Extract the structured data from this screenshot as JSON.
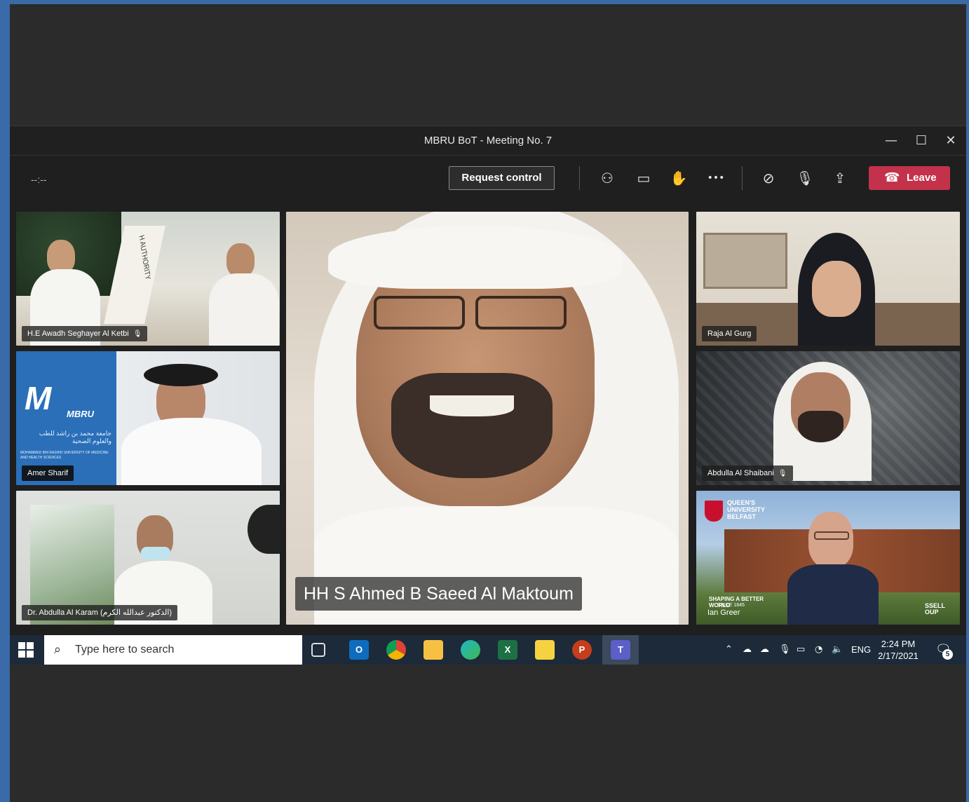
{
  "window": {
    "title": "MBRU BoT - Meeting No. 7",
    "minimize": "—",
    "maximize": "☐",
    "close": "✕"
  },
  "toolbar": {
    "timer": "--:--",
    "request_control": "Request control",
    "leave": "Leave",
    "icons": [
      "people-icon",
      "chat-icon",
      "raise-hand-icon",
      "more-options-icon",
      "camera-off-icon",
      "mic-off-icon",
      "share-screen-icon"
    ],
    "icon_glyphs": {
      "people": "⚇",
      "chat": "▭",
      "hand": "✋",
      "more": "•••",
      "camera": "⊘",
      "mic": "🎙",
      "share": "⇪",
      "phone": "☎"
    }
  },
  "participants": {
    "p1": "H.E Awadh Seghayer Al Ketbi",
    "p2": "Amer Sharif",
    "p3": "Dr. Abdulla Al Karam (الدكتور عبدالله الكرم)",
    "main": "HH S Ahmed B Saeed Al Maktoum",
    "p4": "Raja Al Gurg",
    "p5": "Abdulla Al Shaibani",
    "p6": "Ian Greer"
  },
  "backgrounds": {
    "authority_text": "H AUTHORITY",
    "mbru_logo": "MBRU",
    "mbru_arabic": "جامعة محمد بن راشد للطب والعلوم الصحية",
    "mbru_english": "MOHAMMED BIN RASHID UNIVERSITY OF MEDICINE AND HEALTH SCIENCES",
    "qub_name": "QUEEN'S UNIVERSITY BELFAST",
    "qub_slogan": "SHAPING A BETTER WORLD",
    "qub_since": "SINCE 1845",
    "qub_partial": "SSELL OUP"
  },
  "taskbar": {
    "search_placeholder": "Type here to search",
    "language": "ENG",
    "time": "2:24 PM",
    "date": "2/17/2021",
    "notification_count": "5",
    "apps": [
      "task-view",
      "outlook",
      "chrome",
      "file-explorer",
      "edge",
      "excel",
      "sticky-notes",
      "powerpoint",
      "teams"
    ]
  },
  "colors": {
    "leave": "#c4314b",
    "outer_border": "#3a6aa8",
    "taskbar": "#1c2a3a"
  }
}
